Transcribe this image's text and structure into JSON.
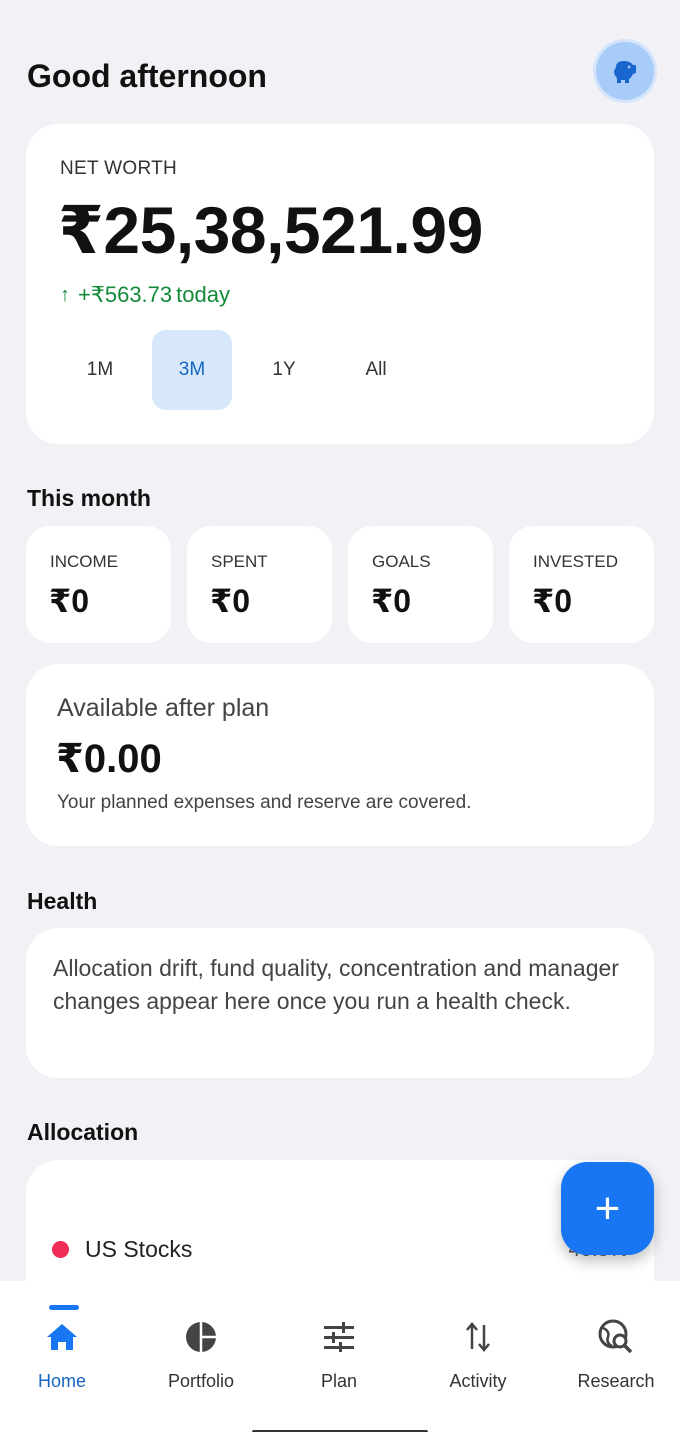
{
  "header": {
    "greeting": "Good afternoon"
  },
  "net_worth": {
    "label": "NET WORTH",
    "value": "₹25,38,521.99",
    "change_arrow": "↑",
    "change": "+₹563.73",
    "change_period": "today",
    "ranges": [
      "1M",
      "3M",
      "1Y",
      "All"
    ],
    "selected_range": "3M"
  },
  "this_month": {
    "title": "This month",
    "stats": [
      {
        "label": "INCOME",
        "value": "₹0"
      },
      {
        "label": "SPENT",
        "value": "₹0"
      },
      {
        "label": "GOALS",
        "value": "₹0"
      },
      {
        "label": "INVESTED",
        "value": "₹0"
      }
    ]
  },
  "available": {
    "title": "Available after plan",
    "value": "₹0.00",
    "description": "Your planned expenses and reserve are covered."
  },
  "health": {
    "title": "Health",
    "text": "Allocation drift, fund quality, concentration and manager changes appear here once you run a health check."
  },
  "allocation": {
    "title": "Allocation",
    "items": [
      {
        "name": "US Stocks",
        "percent": "46.5%",
        "color": "#ef2d56"
      }
    ]
  },
  "fab": {
    "icon": "plus-icon",
    "label": "+"
  },
  "nav": {
    "items": [
      {
        "label": "Home",
        "icon": "home-icon"
      },
      {
        "label": "Portfolio",
        "icon": "pie-chart-icon"
      },
      {
        "label": "Plan",
        "icon": "sliders-icon"
      },
      {
        "label": "Activity",
        "icon": "swap-vertical-icon"
      },
      {
        "label": "Research",
        "icon": "globe-search-icon"
      }
    ],
    "active": "Home"
  },
  "colors": {
    "accent": "#1976f2",
    "positive": "#138a3a",
    "background": "#f1f1f6"
  }
}
